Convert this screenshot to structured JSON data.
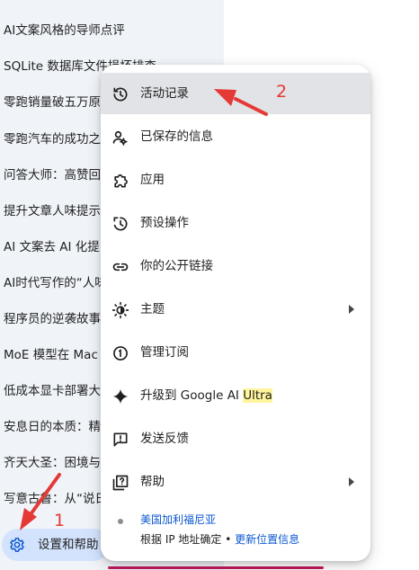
{
  "sidebar": {
    "history": [
      "AI文案风格的导师点评",
      "SQLite 数据库文件损坏排查",
      "零跑销量破五万原",
      "零跑汽车的成功之",
      "问答大师：高赞回",
      "提升文章人味提示",
      "AI 文案去 AI 化提",
      "AI时代写作的“人味",
      "程序员的逆袭故事",
      "MoE 模型在 Mac ",
      "低成本显卡部署大",
      "安息日的本质：精",
      "齐天大圣：困境与",
      "写意古鲁：从“说日"
    ],
    "settings_label": "设置和帮助"
  },
  "menu": {
    "items": [
      {
        "label": "活动记录",
        "icon": "history-icon"
      },
      {
        "label": "已保存的信息",
        "icon": "saved-info-icon"
      },
      {
        "label": "应用",
        "icon": "apps-icon"
      },
      {
        "label": "预设操作",
        "icon": "scheduled-actions-icon"
      },
      {
        "label": "你的公开链接",
        "icon": "link-icon"
      },
      {
        "label": "主题",
        "icon": "theme-icon"
      },
      {
        "label": "管理订阅",
        "icon": "subscription-icon"
      },
      {
        "label_prefix": "升级到 Google AI ",
        "label_highlight": "Ultra",
        "icon": "sparkle-icon"
      },
      {
        "label": "发送反馈",
        "icon": "feedback-icon"
      },
      {
        "label": "帮助",
        "icon": "help-icon"
      }
    ],
    "location": {
      "region": "美国加利福尼亚",
      "source_text": "根据 IP 地址确定",
      "separator": " • ",
      "update_link": "更新位置信息"
    }
  },
  "annotations": {
    "label_1": "1",
    "label_2": "2",
    "color": "#e53935"
  },
  "colors": {
    "sidebar_bg": "#f0f4f9",
    "settings_highlight": "#d3e3fd",
    "menu_active": "#e1e3e6",
    "link": "#0b57d0",
    "ultra_highlight": "#fff59d"
  }
}
